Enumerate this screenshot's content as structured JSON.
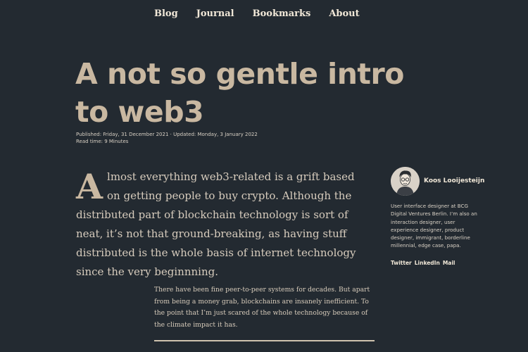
{
  "nav": {
    "items": [
      "Blog",
      "Journal",
      "Bookmarks",
      "About"
    ]
  },
  "article": {
    "title": "A not so gentle intro to web3",
    "published_line": "Published: Friday, 31 December 2021 · Updated: Monday, 3 January 2022",
    "read_time": "Read time: 9 Minutes",
    "dropcap": "A",
    "lead_rest": "lmost everything web3-related is a grift based on getting people to buy crypto. Although the distributed part of blockchain technology is sort of neat, it’s not that ground-breaking, as having stuff distributed is the whole basis of internet technology since the very beginnning.",
    "body_paragraph": "There have been fine peer-to-peer systems for decades. But apart from being a money grab, blockchains are insanely inefficient. To the point that I’m just scared of the whole technology because of the climate impact it has."
  },
  "author": {
    "name": "Koos Looijesteijn",
    "bio": "User interface designer at BCG Digital Ventures Berlin. I’m also an interaction designer, user experience designer, product designer, immigrant, borderline millennial, edge case, papa.",
    "links": [
      "Twitter",
      "LinkedIn",
      "Mail"
    ]
  },
  "colors": {
    "background": "#232a31",
    "title": "#c9b8a1",
    "text": "#d7ccbd"
  }
}
